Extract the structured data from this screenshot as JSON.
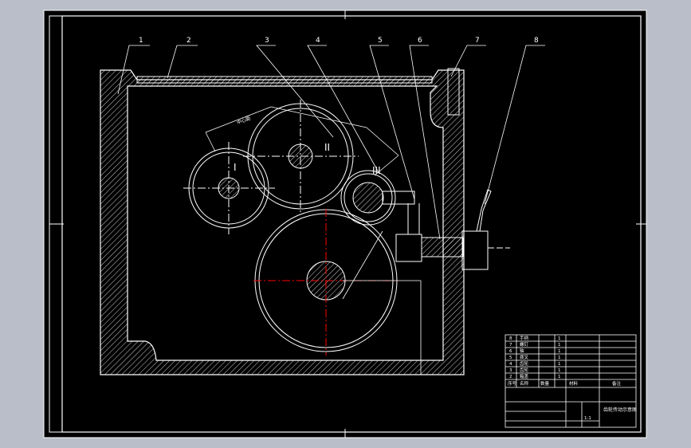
{
  "drawing": {
    "balloons": [
      "1",
      "2",
      "3",
      "4",
      "5",
      "6",
      "7",
      "8"
    ],
    "shaft_labels": {
      "shaft_1": "I",
      "shaft_2": "II",
      "shaft_3": "III"
    },
    "dimension_label": "中心距"
  },
  "title_block": {
    "parts_list": [
      {
        "index": "8",
        "name": "手柄",
        "qty": "1"
      },
      {
        "index": "7",
        "name": "螺钉",
        "qty": "1"
      },
      {
        "index": "6",
        "name": "轴",
        "qty": "1"
      },
      {
        "index": "5",
        "name": "拨叉",
        "qty": "1"
      },
      {
        "index": "4",
        "name": "齿轮",
        "qty": "1"
      },
      {
        "index": "3",
        "name": "齿轮",
        "qty": "1"
      },
      {
        "index": "2",
        "name": "箱盖",
        "qty": "1"
      },
      {
        "index": "1",
        "name": "箱体",
        "qty": "1"
      }
    ],
    "parts_header": {
      "index": "序号",
      "name": "名称",
      "qty": "数量",
      "material": "材料",
      "note": "备注"
    },
    "drawing_title": "齿轮传动示意图",
    "scale": "1:1"
  },
  "colors": {
    "frame_background": "#000000",
    "line_color": "#ffffff",
    "center_line_color": "#ff0000",
    "outer_background": "#b9bec8"
  }
}
